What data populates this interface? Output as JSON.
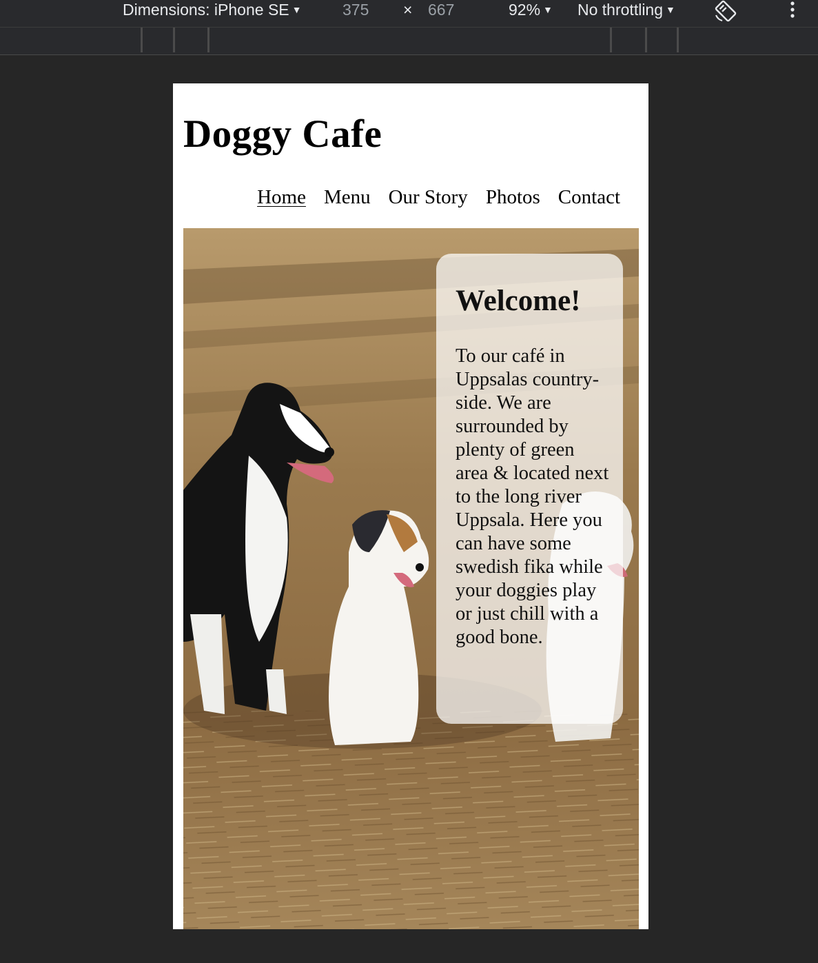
{
  "devtools": {
    "dimensions_label": "Dimensions: iPhone SE",
    "width": "375",
    "times": "×",
    "height": "667",
    "zoom": "92%",
    "throttling": "No throttling",
    "caret": "▼"
  },
  "site": {
    "title": "Doggy Cafe",
    "nav": [
      "Home",
      "Menu",
      "Our Story",
      "Photos",
      "Contact"
    ],
    "active_nav": "Home"
  },
  "welcome": {
    "heading": "Welcome!",
    "body": "To our café in Uppsalas country-side. We are surrounded by plenty of green area & located next to the long river Uppsala. Here you can have some swedish fika while your doggies play or just chill with a good bone."
  },
  "colors": {
    "devtools_bg": "#292a2d",
    "canvas_bg": "#262626",
    "page_bg": "#ffffff",
    "card_bg": "rgba(255,255,255,0.72)"
  },
  "icons": [
    "rotate-icon",
    "more-options-icon"
  ]
}
